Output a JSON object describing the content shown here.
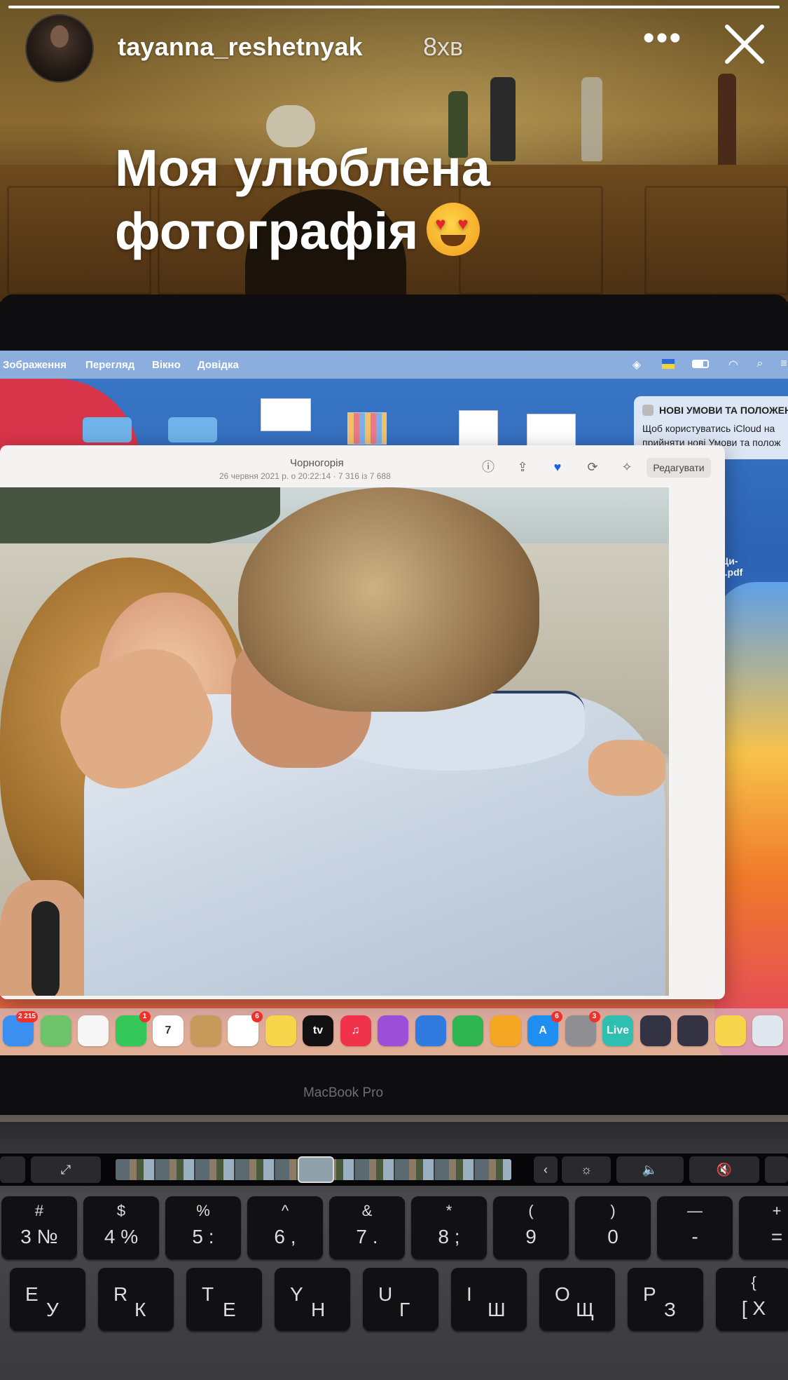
{
  "story": {
    "username": "tayanna_reshetnyak",
    "time_ago": "8хв",
    "more_label": "•••",
    "caption_line1": "Моя улюблена",
    "caption_line2": "фотографія",
    "progress": 1.0
  },
  "menubar": {
    "items": [
      "Зображення",
      "Перегляд",
      "Вікно",
      "Довідка"
    ]
  },
  "notification": {
    "title": "НОВІ УМОВИ ТА ПОЛОЖЕН",
    "line1": "Щоб користуватись iCloud на",
    "line2": "прийняти нові Умови та полож"
  },
  "desktop": {
    "file_label_1": "Ци-",
    "file_label_2": ").pdf"
  },
  "photos_window": {
    "title": "Чорногорія",
    "subtitle": "26 червня 2021 р. о 20:22:14 · 7 316 із 7 688",
    "edit_label": "Редагувати"
  },
  "dock": {
    "apps": [
      {
        "name": "mail",
        "label": "",
        "color": "#3a8ff0",
        "badge": "2 215"
      },
      {
        "name": "maps",
        "label": "",
        "color": "#6cc36a",
        "badge": ""
      },
      {
        "name": "photos",
        "label": "",
        "color": "#f6f6f6",
        "badge": ""
      },
      {
        "name": "facetime",
        "label": "",
        "color": "#34c759",
        "badge": "1"
      },
      {
        "name": "calendar",
        "label": "7",
        "color": "#ffffff",
        "badge": ""
      },
      {
        "name": "contacts",
        "label": "",
        "color": "#c69a5a",
        "badge": ""
      },
      {
        "name": "reminders",
        "label": "",
        "color": "#ffffff",
        "badge": "6"
      },
      {
        "name": "notes",
        "label": "",
        "color": "#f7d54a",
        "badge": ""
      },
      {
        "name": "tv",
        "label": "tv",
        "color": "#111111",
        "badge": ""
      },
      {
        "name": "music",
        "label": "♫",
        "color": "#f0324b",
        "badge": ""
      },
      {
        "name": "podcasts",
        "label": "",
        "color": "#9b4fd8",
        "badge": ""
      },
      {
        "name": "keynote",
        "label": "",
        "color": "#2f7be0",
        "badge": ""
      },
      {
        "name": "numbers",
        "label": "",
        "color": "#2fb550",
        "badge": ""
      },
      {
        "name": "pages",
        "label": "",
        "color": "#f5a623",
        "badge": ""
      },
      {
        "name": "app-store",
        "label": "A",
        "color": "#1f8ef1",
        "badge": "6"
      },
      {
        "name": "system-preferences",
        "label": "",
        "color": "#8e8e93",
        "badge": "3"
      },
      {
        "name": "live",
        "label": "Live",
        "color": "#2fbfb0",
        "badge": ""
      },
      {
        "name": "utility-1",
        "label": "",
        "color": "#333344",
        "badge": ""
      },
      {
        "name": "utility-2",
        "label": "",
        "color": "#333344",
        "badge": ""
      },
      {
        "name": "stickies",
        "label": "",
        "color": "#f7d54a",
        "badge": ""
      },
      {
        "name": "preview",
        "label": "",
        "color": "#dfe6ee",
        "badge": ""
      }
    ]
  },
  "laptop": {
    "brand": "MacBook Pro"
  },
  "keyboard": {
    "row1": [
      {
        "top": "#",
        "l": "3",
        "r": "№"
      },
      {
        "top": "$",
        "l": "4",
        "r": "%"
      },
      {
        "top": "%",
        "l": "5",
        "r": ":"
      },
      {
        "top": "^",
        "l": "6",
        "r": ","
      },
      {
        "top": "&",
        "l": "7",
        "r": "."
      },
      {
        "top": "*",
        "l": "8",
        "r": ";"
      },
      {
        "top": "(",
        "l": "9",
        "r": ""
      },
      {
        "top": ")",
        "l": "0",
        "r": ""
      },
      {
        "top": "—",
        "l": "-",
        "r": ""
      },
      {
        "top": "+",
        "l": "=",
        "r": ""
      }
    ],
    "row2": [
      {
        "top": "",
        "l": "E",
        "r": "У"
      },
      {
        "top": "",
        "l": "R",
        "r": "К"
      },
      {
        "top": "",
        "l": "T",
        "r": "Е"
      },
      {
        "top": "",
        "l": "Y",
        "r": "Н"
      },
      {
        "top": "",
        "l": "U",
        "r": "Г"
      },
      {
        "top": "",
        "l": "I",
        "r": "Ш"
      },
      {
        "top": "",
        "l": "O",
        "r": "Щ"
      },
      {
        "top": "",
        "l": "P",
        "r": "З"
      },
      {
        "top": "{",
        "l": "[",
        "r": "Х"
      }
    ]
  }
}
